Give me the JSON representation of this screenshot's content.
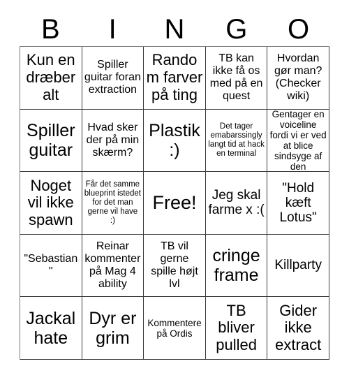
{
  "header": {
    "letters": [
      "B",
      "I",
      "N",
      "G",
      "O"
    ]
  },
  "grid": {
    "columns": 5,
    "rows": 5,
    "free_space": {
      "row": 2,
      "col": 2,
      "label": "Free!"
    },
    "cells": [
      [
        {
          "text": "Kun en dræber alt",
          "size": "xl"
        },
        {
          "text": "Spiller guitar foran extraction",
          "size": "m"
        },
        {
          "text": "Random farver på ting",
          "size": "xl"
        },
        {
          "text": "TB kan ikke få os med på en quest",
          "size": "m"
        },
        {
          "text": "Hvordan gør man? (Checker wiki)",
          "size": "m"
        }
      ],
      [
        {
          "text": "Spiller guitar",
          "size": "xxl"
        },
        {
          "text": "Hvad sker der på min skærm?",
          "size": "m"
        },
        {
          "text": "Plastik :)",
          "size": "xxl"
        },
        {
          "text": "Det tager emabarssingly langt tid at hack en terminal",
          "size": "xs"
        },
        {
          "text": "Gentager en voiceline fordi vi er ved at blice sindsyge af den",
          "size": "s"
        }
      ],
      [
        {
          "text": "Noget vil ikke spawn",
          "size": "xl"
        },
        {
          "text": "Får det samme blueprint istedet for det man gerne vil have :)",
          "size": "xs"
        },
        {
          "text": "Free!",
          "size": "free"
        },
        {
          "text": "Jeg skal farme x :(",
          "size": "l"
        },
        {
          "text": "\"Hold kæft Lotus\"",
          "size": "l"
        }
      ],
      [
        {
          "text": "\"Sebastian\"",
          "size": "m"
        },
        {
          "text": "Reinar kommenter på Mag 4 ability",
          "size": "m"
        },
        {
          "text": "TB vil gerne spille højt lvl",
          "size": "m"
        },
        {
          "text": "cringe frame",
          "size": "xxl"
        },
        {
          "text": "Killparty",
          "size": "l"
        }
      ],
      [
        {
          "text": "Jackal hate",
          "size": "xxl"
        },
        {
          "text": "Dyr er grim",
          "size": "xxl"
        },
        {
          "text": "Kommentere på Ordis",
          "size": "s"
        },
        {
          "text": "TB bliver pulled",
          "size": "xl"
        },
        {
          "text": "Gider ikke extract",
          "size": "xl"
        }
      ]
    ]
  },
  "colors": {
    "background": "#ffffff",
    "text": "#000000",
    "cell_border": "#3a3a3a",
    "grid_outer_border": "#7a7a7a"
  }
}
